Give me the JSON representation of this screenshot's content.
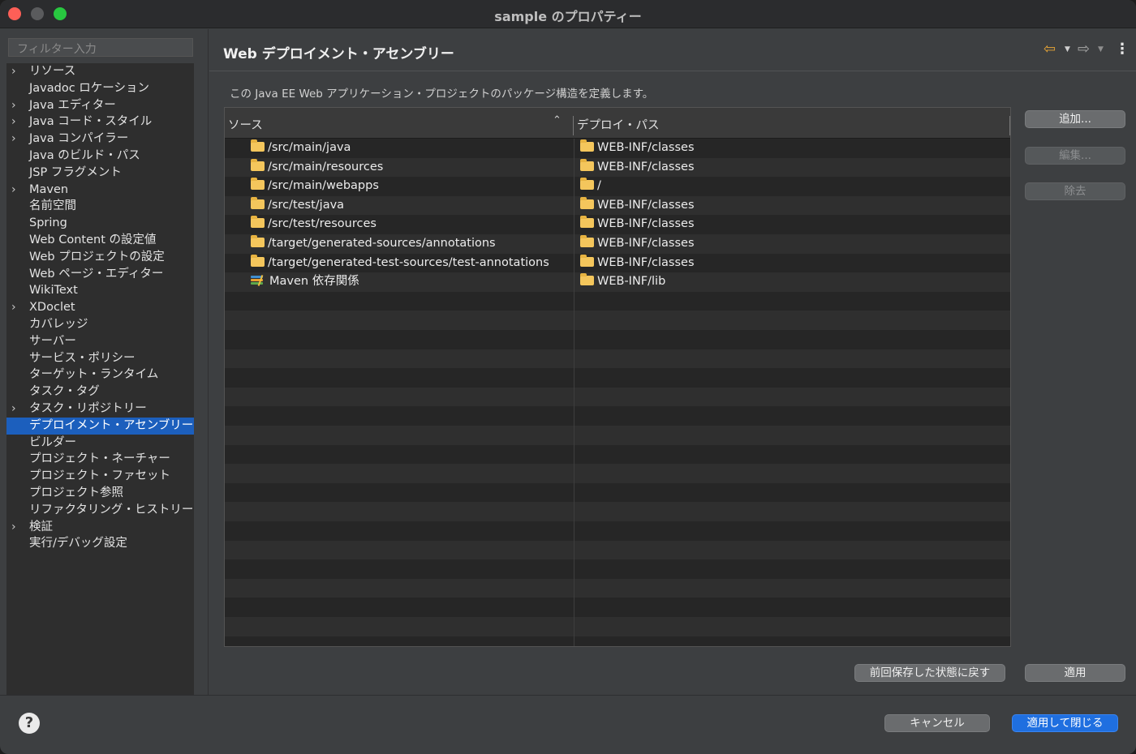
{
  "window": {
    "title": "sample のプロパティー"
  },
  "sidebar": {
    "filter_placeholder": "フィルター入力",
    "items": [
      {
        "label": "リソース",
        "expandable": true
      },
      {
        "label": "Javadoc ロケーション",
        "expandable": false
      },
      {
        "label": "Java エディター",
        "expandable": true
      },
      {
        "label": "Java コード・スタイル",
        "expandable": true
      },
      {
        "label": "Java コンパイラー",
        "expandable": true
      },
      {
        "label": "Java のビルド・パス",
        "expandable": false
      },
      {
        "label": "JSP フラグメント",
        "expandable": false
      },
      {
        "label": "Maven",
        "expandable": true
      },
      {
        "label": "名前空間",
        "expandable": false
      },
      {
        "label": "Spring",
        "expandable": false
      },
      {
        "label": "Web Content の設定値",
        "expandable": false
      },
      {
        "label": "Web プロジェクトの設定",
        "expandable": false
      },
      {
        "label": "Web ページ・エディター",
        "expandable": false
      },
      {
        "label": "WikiText",
        "expandable": false
      },
      {
        "label": "XDoclet",
        "expandable": true
      },
      {
        "label": "カバレッジ",
        "expandable": false
      },
      {
        "label": "サーバー",
        "expandable": false
      },
      {
        "label": "サービス・ポリシー",
        "expandable": false
      },
      {
        "label": "ターゲット・ランタイム",
        "expandable": false
      },
      {
        "label": "タスク・タグ",
        "expandable": false
      },
      {
        "label": "タスク・リポジトリー",
        "expandable": true
      },
      {
        "label": "デプロイメント・アセンブリー",
        "expandable": false,
        "selected": true
      },
      {
        "label": "ビルダー",
        "expandable": false
      },
      {
        "label": "プロジェクト・ネーチャー",
        "expandable": false
      },
      {
        "label": "プロジェクト・ファセット",
        "expandable": false
      },
      {
        "label": "プロジェクト参照",
        "expandable": false
      },
      {
        "label": "リファクタリング・ヒストリー",
        "expandable": false
      },
      {
        "label": "検証",
        "expandable": true
      },
      {
        "label": "実行/デバッグ設定",
        "expandable": false
      }
    ]
  },
  "main": {
    "title": "Web デプロイメント・アセンブリー",
    "description": "この Java EE Web アプリケーション・プロジェクトのパッケージ構造を定義します。",
    "icons": {
      "back": "arrow-left-icon",
      "forward": "arrow-right-icon",
      "menu": "kebab-menu-icon"
    },
    "table": {
      "headers": {
        "source": "ソース",
        "deploy_path": "デプロイ・パス"
      },
      "rows": [
        {
          "source": "/src/main/java",
          "deploy": "WEB-INF/classes",
          "icon": "folder-icon"
        },
        {
          "source": "/src/main/resources",
          "deploy": "WEB-INF/classes",
          "icon": "folder-icon"
        },
        {
          "source": "/src/main/webapps",
          "deploy": "/",
          "icon": "folder-icon"
        },
        {
          "source": "/src/test/java",
          "deploy": "WEB-INF/classes",
          "icon": "folder-icon"
        },
        {
          "source": "/src/test/resources",
          "deploy": "WEB-INF/classes",
          "icon": "folder-icon"
        },
        {
          "source": "/target/generated-sources/annotations",
          "deploy": "WEB-INF/classes",
          "icon": "folder-icon"
        },
        {
          "source": "/target/generated-test-sources/test-annotations",
          "deploy": "WEB-INF/classes",
          "icon": "folder-icon"
        },
        {
          "source": "Maven 依存関係",
          "deploy": "WEB-INF/lib",
          "icon": "maven-library-icon"
        }
      ]
    },
    "buttons": {
      "add": "追加...",
      "edit": "編集...",
      "remove": "除去",
      "revert": "前回保存した状態に戻す",
      "apply": "適用"
    }
  },
  "footer": {
    "cancel": "キャンセル",
    "apply_close": "適用して閉じる"
  },
  "colors": {
    "selection": "#1c5fbd",
    "primary_button": "#1f6fe0",
    "folder": "#f4c65c"
  }
}
